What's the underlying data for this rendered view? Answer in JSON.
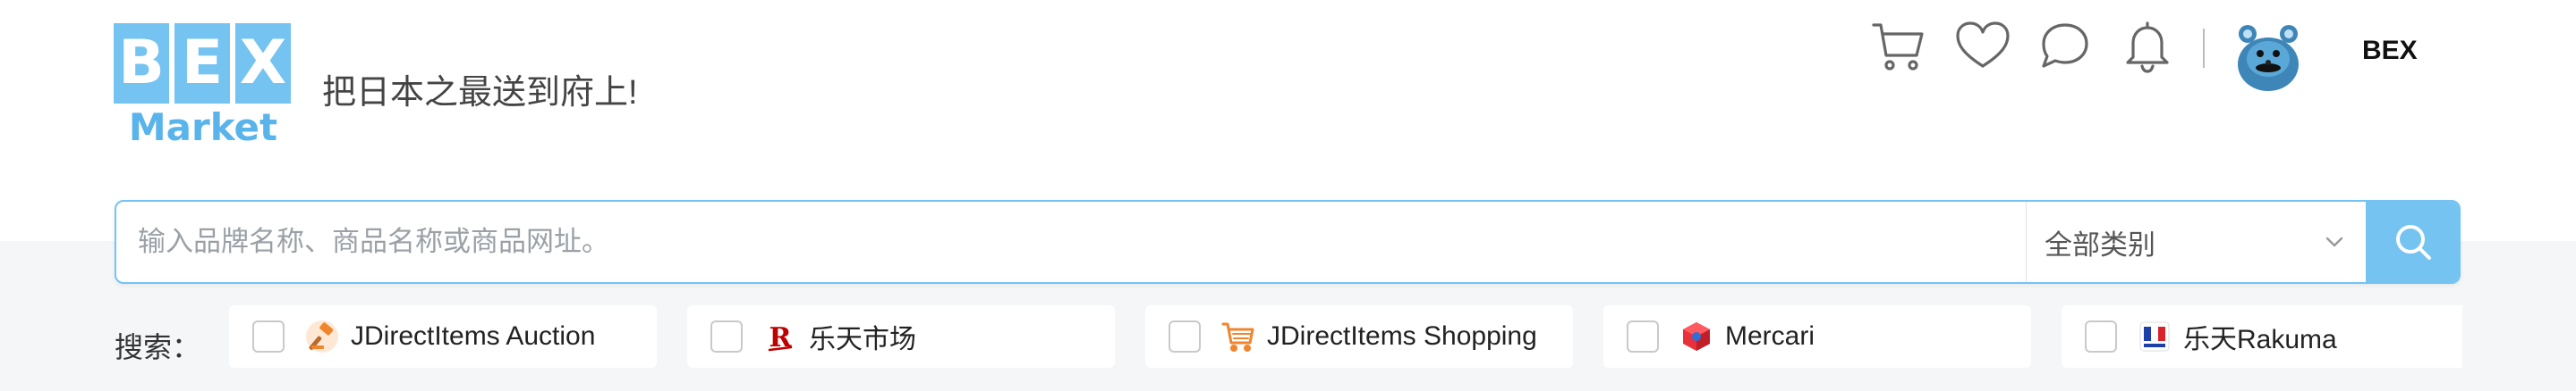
{
  "brand": {
    "letters": [
      "B",
      "E",
      "X"
    ],
    "wordmark": "Market",
    "slogan": "把日本之最送到府上!",
    "color": "#75c3f1"
  },
  "header": {
    "icons": [
      "cart-icon",
      "heart-icon",
      "chat-icon",
      "bell-icon"
    ],
    "username": "BEX"
  },
  "search": {
    "placeholder": "输入品牌名称、商品名称或商品网址。",
    "value": "",
    "category": "全部类别",
    "button_icon": "search-icon"
  },
  "sources": {
    "label": "搜索：",
    "items": [
      {
        "label": "JDirectItems Auction",
        "icon": "gavel-icon",
        "checked": false
      },
      {
        "label": "乐天市场",
        "icon": "rakuten-r-icon",
        "checked": false
      },
      {
        "label": "JDirectItems Shopping",
        "icon": "shopping-cart-icon",
        "checked": false
      },
      {
        "label": "Mercari",
        "icon": "mercari-cube-icon",
        "checked": false
      },
      {
        "label": "乐天Rakuma",
        "icon": "rakuma-icon",
        "checked": false
      }
    ]
  },
  "colors": {
    "accent": "#75c3f1",
    "background_band": "#f5f6f8"
  }
}
